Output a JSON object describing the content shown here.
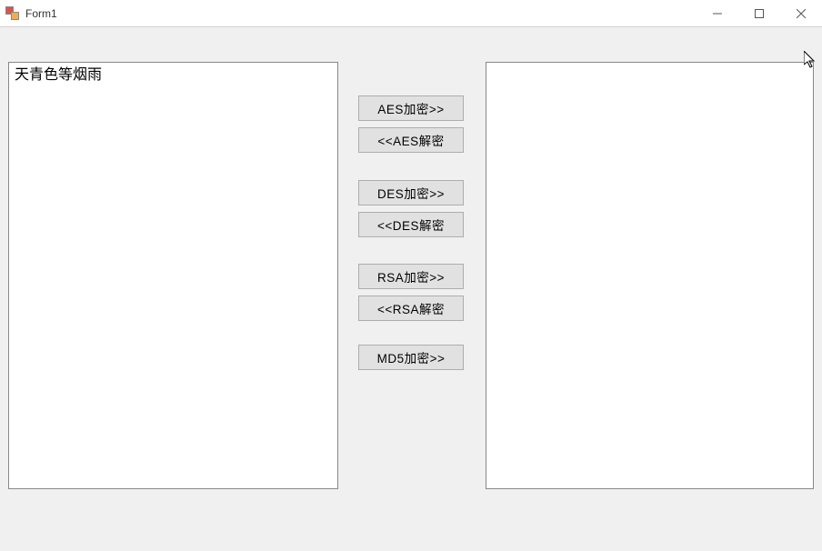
{
  "window": {
    "title": "Form1"
  },
  "textboxes": {
    "left_value": "天青色等烟雨",
    "right_value": ""
  },
  "buttons": {
    "aes_encrypt": "AES加密>>",
    "aes_decrypt": "<<AES解密",
    "des_encrypt": "DES加密>>",
    "des_decrypt": "<<DES解密",
    "rsa_encrypt": "RSA加密>>",
    "rsa_decrypt": "<<RSA解密",
    "md5_encrypt": "MD5加密>>"
  }
}
